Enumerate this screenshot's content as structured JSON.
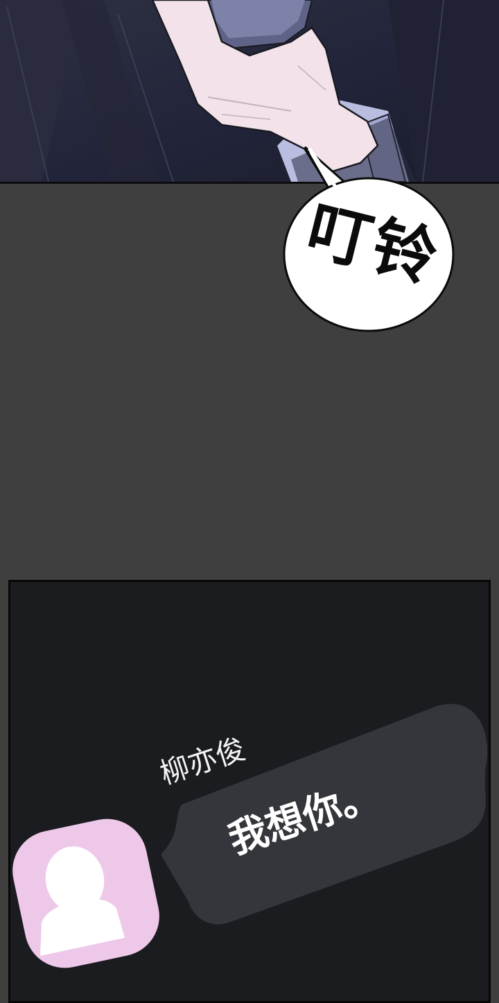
{
  "sfx": {
    "text": "叮铃"
  },
  "chat": {
    "sender_name": "柳亦俊",
    "message": "我想你。",
    "avatar_icon": "person-silhouette-icon"
  },
  "colors": {
    "gutter": "#3f3f3f",
    "panel_dark": "#1b1c1f",
    "bubble": "#34363b",
    "avatar_bg": "#eec8e8",
    "text_white": "#ffffff"
  }
}
